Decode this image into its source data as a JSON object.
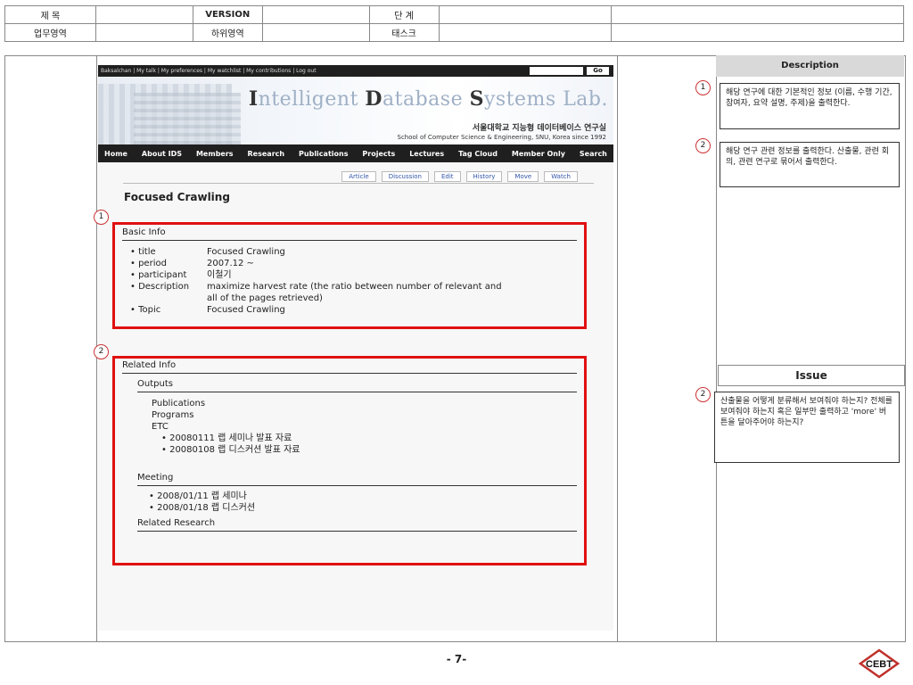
{
  "header": {
    "row1": [
      "제 목",
      "VERSION",
      "단 계"
    ],
    "row2": [
      "업무영역",
      "하위영역",
      "태스크"
    ]
  },
  "wiki": {
    "topbar": "Baksalchan | My talk | My preferences | My watchlist | My contributions | Log out",
    "go": "Go",
    "lab_title_parts": [
      "I",
      "ntelligent ",
      "D",
      "atabase ",
      "S",
      "ystems Lab."
    ],
    "lab_kor": "서울대학교 지능형 데이터베이스 연구실",
    "lab_eng": "School of Computer Science & Engineering, SNU, Korea since 1992",
    "nav": [
      "Home",
      "About IDS",
      "Members",
      "Research",
      "Publications",
      "Projects",
      "Lectures",
      "Tag Cloud",
      "Member Only",
      "Search"
    ],
    "tabs": [
      "Article",
      "Discussion",
      "Edit",
      "History",
      "Move",
      "Watch"
    ],
    "page_title": "Focused Crawling",
    "basic": {
      "heading": "Basic Info",
      "rows": [
        {
          "k": "• title",
          "v": "Focused Crawling"
        },
        {
          "k": "• period",
          "v": "2007.12 ~"
        },
        {
          "k": "• participant",
          "v": "이철기"
        },
        {
          "k": "• Description",
          "v": "maximize harvest rate (the ratio between number of relevant and"
        },
        {
          "k": "",
          "v": "all of the pages retrieved)"
        },
        {
          "k": "• Topic",
          "v": "Focused Crawling"
        }
      ]
    },
    "related": {
      "heading": "Related Info",
      "outputs_heading": "Outputs",
      "outputs": [
        "Publications",
        "Programs",
        "ETC"
      ],
      "etc_items": [
        "• 20080111 랩 세미나 발표 자료",
        "• 20080108 랩 디스커션 발표 자료"
      ],
      "meeting_heading": "Meeting",
      "meetings": [
        "• 2008/01/11 랩 세미나",
        "• 2008/01/18 랩 디스커션"
      ],
      "research_heading": "Related Research"
    }
  },
  "badges": [
    "1",
    "2"
  ],
  "right": {
    "description_heading": "Description",
    "notes": [
      "해당 연구에 대한 기본적인 정보 (이름, 수행 기간, 참여자, 요약 설명, 주제)을 출력한다.",
      "해당 연구 관련 정보를 출력한다. 산출물, 관련 회의, 관련 연구로 묶어서 출력한다."
    ],
    "issue_heading": "Issue",
    "issue_note": "산출물을 어떻게 분류해서 보여줘야 하는지? 전체를 보여줘야 하는지 혹은 일부만 출력하고 'more' 버튼을 달아주어야 하는지?"
  },
  "footer": {
    "page_number": "- 7-",
    "logo_text": "CEBT"
  }
}
